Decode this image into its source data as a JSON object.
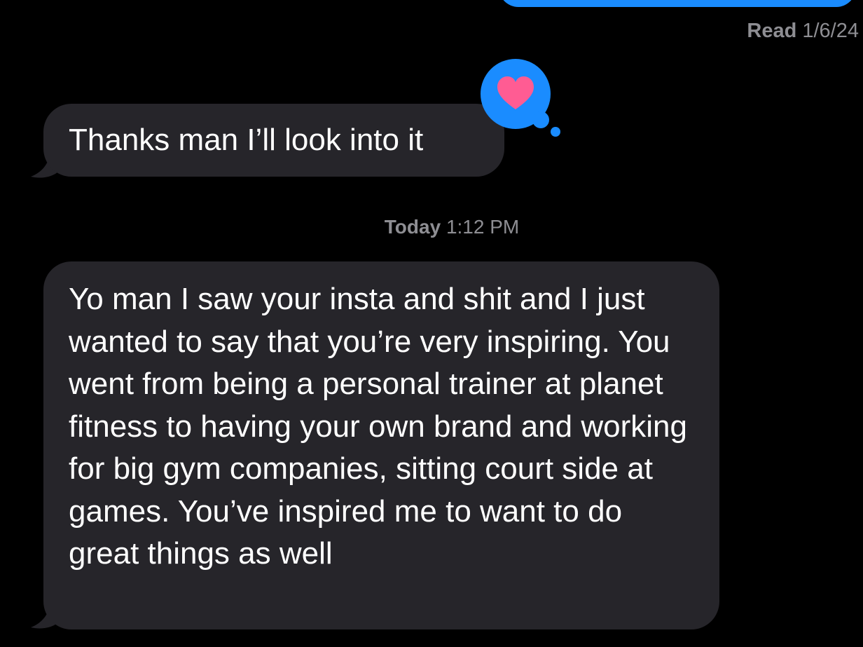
{
  "thread": {
    "read_label": "Read",
    "read_date": "1/6/24",
    "messages": [
      {
        "direction": "received",
        "text": "Thanks man I’ll look into it",
        "tapback": "heart-icon"
      },
      {
        "direction": "received",
        "text": "Yo man I saw your insta and shit and I just wanted to say that you’re very inspiring. You went from being a personal trainer at planet fitness to having your own brand and working for big gym companies, sitting court side at games. You’ve inspired me to want to do great things as well"
      }
    ],
    "timestamp_day": "Today",
    "timestamp_time": "1:12 PM"
  },
  "colors": {
    "background": "#000000",
    "sent_bubble": "#1a8cff",
    "received_bubble": "#26252a",
    "heart": "#ff5c93",
    "secondary_text": "#8e8e93"
  }
}
